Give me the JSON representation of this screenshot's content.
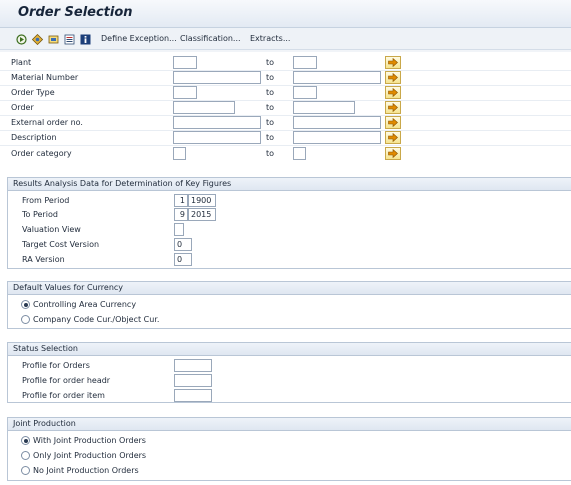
{
  "header": {
    "title": "Order Selection"
  },
  "toolbar": {
    "icons": [
      "execute-icon",
      "get-variant-icon",
      "save-variant-icon",
      "variant-list-icon",
      "info-icon"
    ],
    "define_exception": "Define Exception...",
    "classification": "Classification...",
    "extracts": "Extracts..."
  },
  "selection": {
    "to_label": "to",
    "plant": {
      "label": "Plant",
      "from": "",
      "to": ""
    },
    "material_number": {
      "label": "Material Number",
      "from": "",
      "to": ""
    },
    "order_type": {
      "label": "Order Type",
      "from": "",
      "to": ""
    },
    "order": {
      "label": "Order",
      "from": "",
      "to": ""
    },
    "external_order_no": {
      "label": "External order no.",
      "from": "",
      "to": ""
    },
    "description": {
      "label": "Description",
      "from": "",
      "to": ""
    },
    "order_category": {
      "label": "Order category",
      "from": "",
      "to": ""
    }
  },
  "results_analysis": {
    "header": "Results Analysis Data for Determination of Key Figures",
    "from_period": {
      "label": "From Period",
      "period": "1",
      "year": "1900"
    },
    "to_period": {
      "label": "To Period",
      "period": "9",
      "year": "2015"
    },
    "valuation_view": {
      "label": "Valuation View",
      "value": ""
    },
    "target_cost_version": {
      "label": "Target Cost Version",
      "value": "0"
    },
    "ra_version": {
      "label": "RA Version",
      "value": "0"
    }
  },
  "currency": {
    "header": "Default Values for Currency",
    "options": [
      "Controlling Area Currency",
      "Company Code Cur./Object Cur."
    ],
    "selected": 0
  },
  "status": {
    "header": "Status Selection",
    "profile_orders": {
      "label": "Profile for Orders",
      "value": ""
    },
    "profile_order_header": {
      "label": "Profile for order headr",
      "value": ""
    },
    "profile_order_item": {
      "label": "Profile for order item",
      "value": ""
    }
  },
  "joint_production": {
    "header": "Joint Production",
    "options": [
      "With Joint Production Orders",
      "Only Joint Production Orders",
      "No Joint Production Orders"
    ],
    "selected": 0
  },
  "colors": {
    "accent_yellow": "#f6e48e",
    "arrow_orange": "#e08a00",
    "group_border": "#b9c6d6"
  }
}
